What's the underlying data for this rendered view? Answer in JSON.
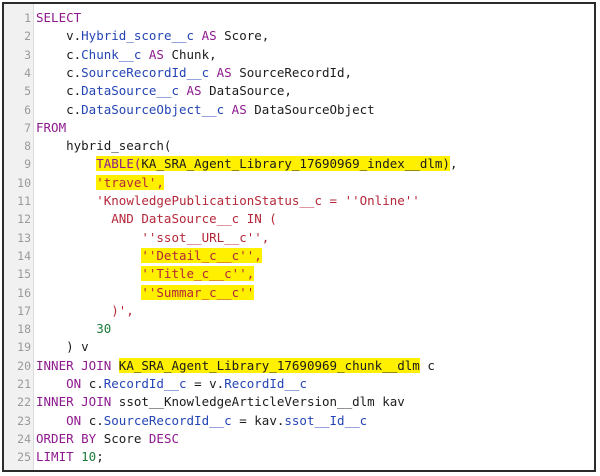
{
  "lines": [
    {
      "n": "1",
      "t": [
        {
          "s": "SELECT",
          "c": "kw"
        }
      ]
    },
    {
      "n": "2",
      "t": [
        {
          "s": "    v.",
          "c": "tx"
        },
        {
          "s": "Hybrid_score__c",
          "c": "fl"
        },
        {
          "s": " AS ",
          "c": "kw"
        },
        {
          "s": "Score,",
          "c": "tx"
        }
      ]
    },
    {
      "n": "3",
      "t": [
        {
          "s": "    c.",
          "c": "tx"
        },
        {
          "s": "Chunk__c",
          "c": "fl"
        },
        {
          "s": " AS ",
          "c": "kw"
        },
        {
          "s": "Chunk,",
          "c": "tx"
        }
      ]
    },
    {
      "n": "4",
      "t": [
        {
          "s": "    c.",
          "c": "tx"
        },
        {
          "s": "SourceRecordId__c",
          "c": "fl"
        },
        {
          "s": " AS ",
          "c": "kw"
        },
        {
          "s": "SourceRecordId,",
          "c": "tx"
        }
      ]
    },
    {
      "n": "5",
      "t": [
        {
          "s": "    c.",
          "c": "tx"
        },
        {
          "s": "DataSource__c",
          "c": "fl"
        },
        {
          "s": " AS ",
          "c": "kw"
        },
        {
          "s": "DataSource,",
          "c": "tx"
        }
      ]
    },
    {
      "n": "6",
      "t": [
        {
          "s": "    c.",
          "c": "tx"
        },
        {
          "s": "DataSourceObject__c",
          "c": "fl"
        },
        {
          "s": " AS ",
          "c": "kw"
        },
        {
          "s": "DataSourceObject",
          "c": "tx"
        }
      ]
    },
    {
      "n": "7",
      "t": [
        {
          "s": "FROM",
          "c": "kw"
        }
      ]
    },
    {
      "n": "8",
      "t": [
        {
          "s": "    hybrid_search(",
          "c": "tx"
        }
      ]
    },
    {
      "n": "9",
      "t": [
        {
          "s": "        ",
          "c": "tx"
        },
        {
          "s": "TABLE(",
          "c": "kw",
          "h": true
        },
        {
          "s": "KA_SRA_Agent_Library_17690969_index__dlm)",
          "c": "tx",
          "h": true
        },
        {
          "s": ",",
          "c": "tx"
        }
      ]
    },
    {
      "n": "10",
      "t": [
        {
          "s": "        ",
          "c": "tx"
        },
        {
          "s": "'travel',",
          "c": "st",
          "h": true
        }
      ]
    },
    {
      "n": "11",
      "t": [
        {
          "s": "        ",
          "c": "tx"
        },
        {
          "s": "'KnowledgePublicationStatus__c = ''Online''",
          "c": "st"
        }
      ]
    },
    {
      "n": "12",
      "t": [
        {
          "s": "          AND DataSource__c IN (",
          "c": "st"
        }
      ]
    },
    {
      "n": "13",
      "t": [
        {
          "s": "              ''ssot__URL__c'',",
          "c": "st"
        }
      ]
    },
    {
      "n": "14",
      "t": [
        {
          "s": "              ",
          "c": "tx"
        },
        {
          "s": "''Detail_c__c'',",
          "c": "st",
          "h": true
        }
      ]
    },
    {
      "n": "15",
      "t": [
        {
          "s": "              ",
          "c": "tx"
        },
        {
          "s": "''Title_c__c'',",
          "c": "st",
          "h": true
        }
      ]
    },
    {
      "n": "16",
      "t": [
        {
          "s": "              ",
          "c": "tx"
        },
        {
          "s": "''Summar_c__c''",
          "c": "st",
          "h": true
        }
      ]
    },
    {
      "n": "17",
      "t": [
        {
          "s": "          )',",
          "c": "st"
        }
      ]
    },
    {
      "n": "18",
      "t": [
        {
          "s": "        ",
          "c": "tx"
        },
        {
          "s": "30",
          "c": "nm"
        }
      ]
    },
    {
      "n": "19",
      "t": [
        {
          "s": "    ) ",
          "c": "pn"
        },
        {
          "s": "v",
          "c": "tx"
        }
      ]
    },
    {
      "n": "20",
      "t": [
        {
          "s": "INNER JOIN ",
          "c": "kw"
        },
        {
          "s": "KA_SRA_Agent_Library_17690969_chunk__dlm",
          "c": "tx",
          "h": true
        },
        {
          "s": " c",
          "c": "tx"
        }
      ]
    },
    {
      "n": "21",
      "t": [
        {
          "s": "    ON ",
          "c": "kw"
        },
        {
          "s": "c.",
          "c": "tx"
        },
        {
          "s": "RecordId__c",
          "c": "fl"
        },
        {
          "s": " = v.",
          "c": "tx"
        },
        {
          "s": "RecordId__c",
          "c": "fl"
        }
      ]
    },
    {
      "n": "22",
      "t": [
        {
          "s": "INNER JOIN ",
          "c": "kw"
        },
        {
          "s": "ssot__KnowledgeArticleVersion__dlm kav",
          "c": "tx"
        }
      ]
    },
    {
      "n": "23",
      "t": [
        {
          "s": "    ON ",
          "c": "kw"
        },
        {
          "s": "c.",
          "c": "tx"
        },
        {
          "s": "SourceRecordId__c",
          "c": "fl"
        },
        {
          "s": " = kav.",
          "c": "tx"
        },
        {
          "s": "ssot__Id__c",
          "c": "fl"
        }
      ]
    },
    {
      "n": "24",
      "t": [
        {
          "s": "ORDER BY ",
          "c": "kw"
        },
        {
          "s": "Score ",
          "c": "tx"
        },
        {
          "s": "DESC",
          "c": "kw"
        }
      ]
    },
    {
      "n": "25",
      "t": [
        {
          "s": "LIMIT ",
          "c": "kw"
        },
        {
          "s": "10",
          "c": "nm"
        },
        {
          "s": ";",
          "c": "tx"
        }
      ]
    }
  ]
}
